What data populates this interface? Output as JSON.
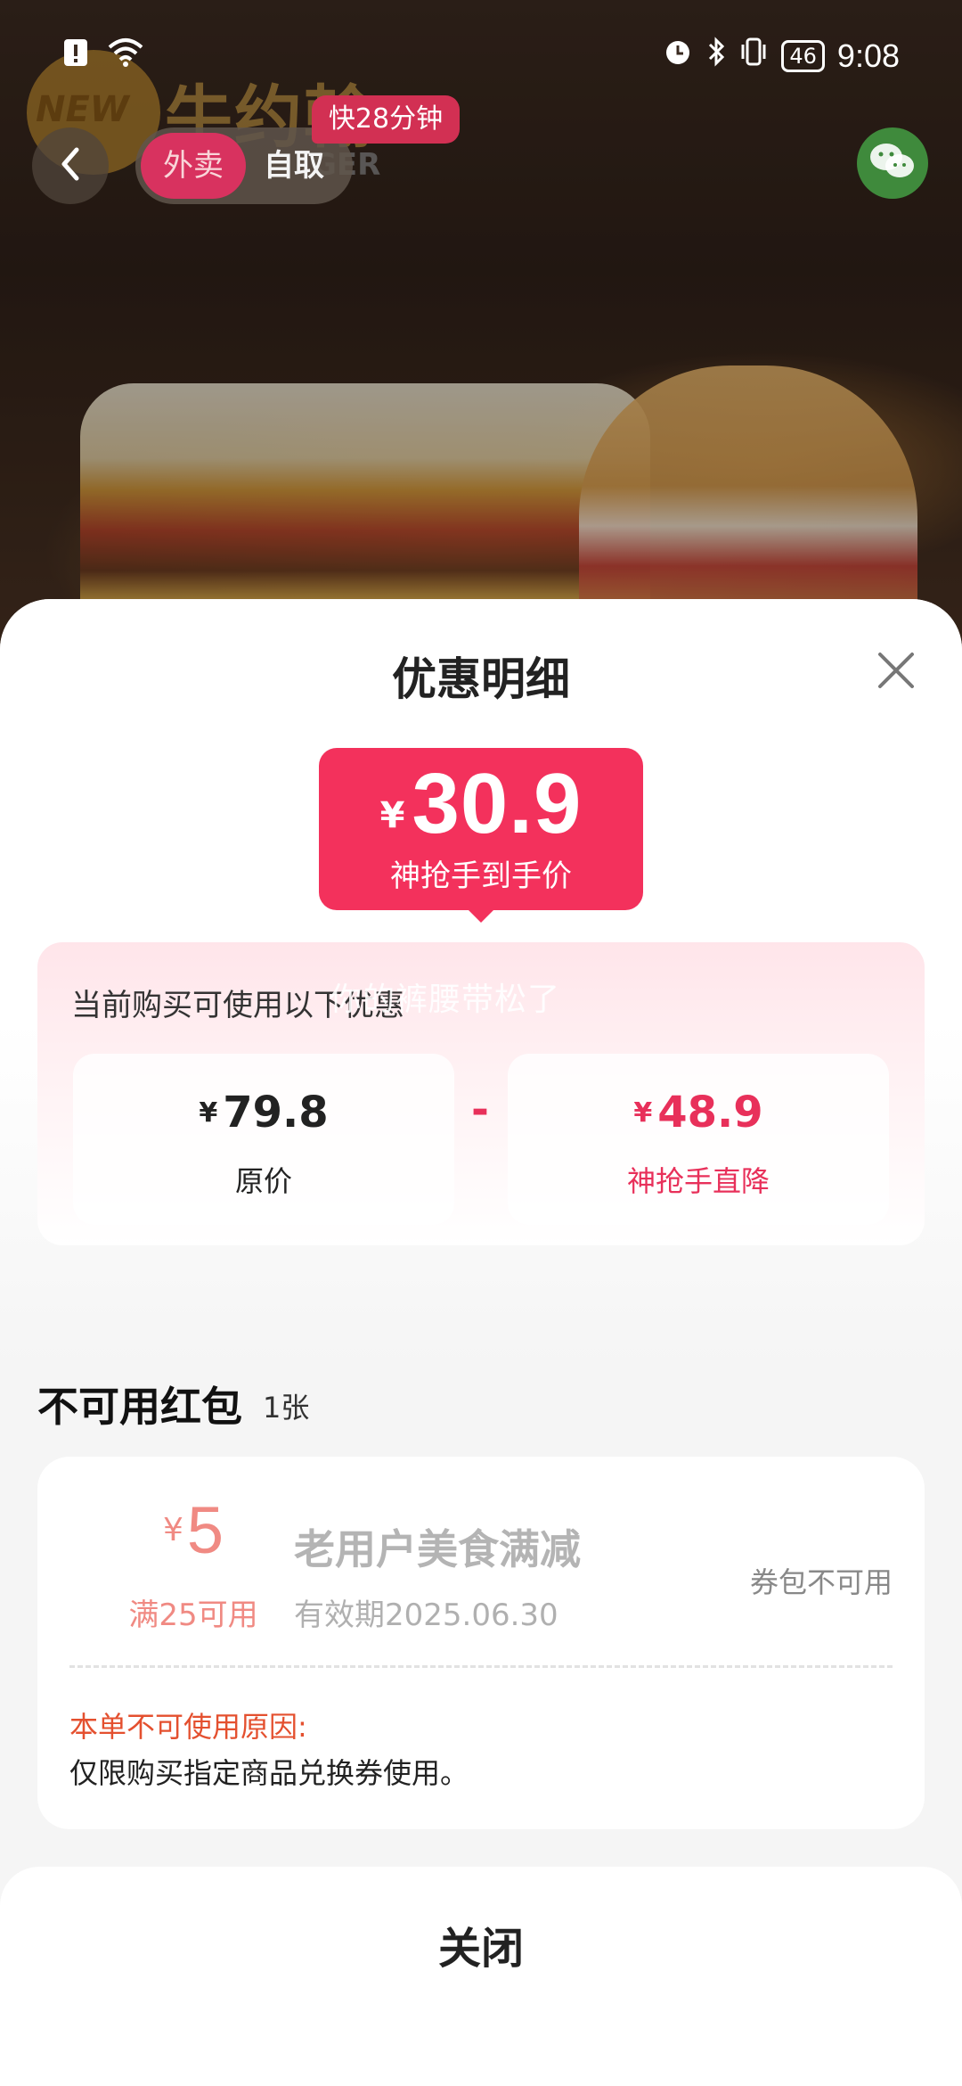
{
  "status_bar": {
    "time": "9:08",
    "battery": "46",
    "icons": [
      "alert-icon",
      "wifi-icon",
      "alarm-icon",
      "bluetooth-icon",
      "vibrate-icon",
      "battery-icon"
    ]
  },
  "store": {
    "brand_name": "牛约翰",
    "brand_logo_text": "NEW",
    "brand_sub": "GER",
    "mode_takeout": "外卖",
    "mode_pickup": "自取",
    "eta_badge": "快28分钟"
  },
  "sheet": {
    "title": "优惠明细",
    "price": {
      "currency": "¥",
      "value": "30.9",
      "label": "神抢手到手价"
    },
    "discount_intro": "当前购买可使用以下优惠",
    "watermark": "你的裤腰带松了",
    "original": {
      "currency": "¥",
      "value": "79.8",
      "label": "原价"
    },
    "minus": "-",
    "discount": {
      "currency": "¥",
      "value": "48.9",
      "label": "神抢手直降"
    }
  },
  "unavailable": {
    "title": "不可用红包",
    "count": "1张",
    "coupon": {
      "currency": "¥",
      "amount": "5",
      "condition": "满25可用",
      "name": "老用户美食满减",
      "expiry": "有效期2025.06.30",
      "status": "券包不可用",
      "reason_label": "本单不可使用原因:",
      "reason_text": "仅限购买指定商品兑换券使用。"
    }
  },
  "footer": {
    "close_label": "关闭"
  },
  "colors": {
    "accent": "#f3315c",
    "discount_text": "#e8305a",
    "coupon_amount": "#f08a83",
    "reason_label": "#e4502f",
    "takeout_toggle": "#d8325f",
    "share_green": "#3f8a3c"
  }
}
